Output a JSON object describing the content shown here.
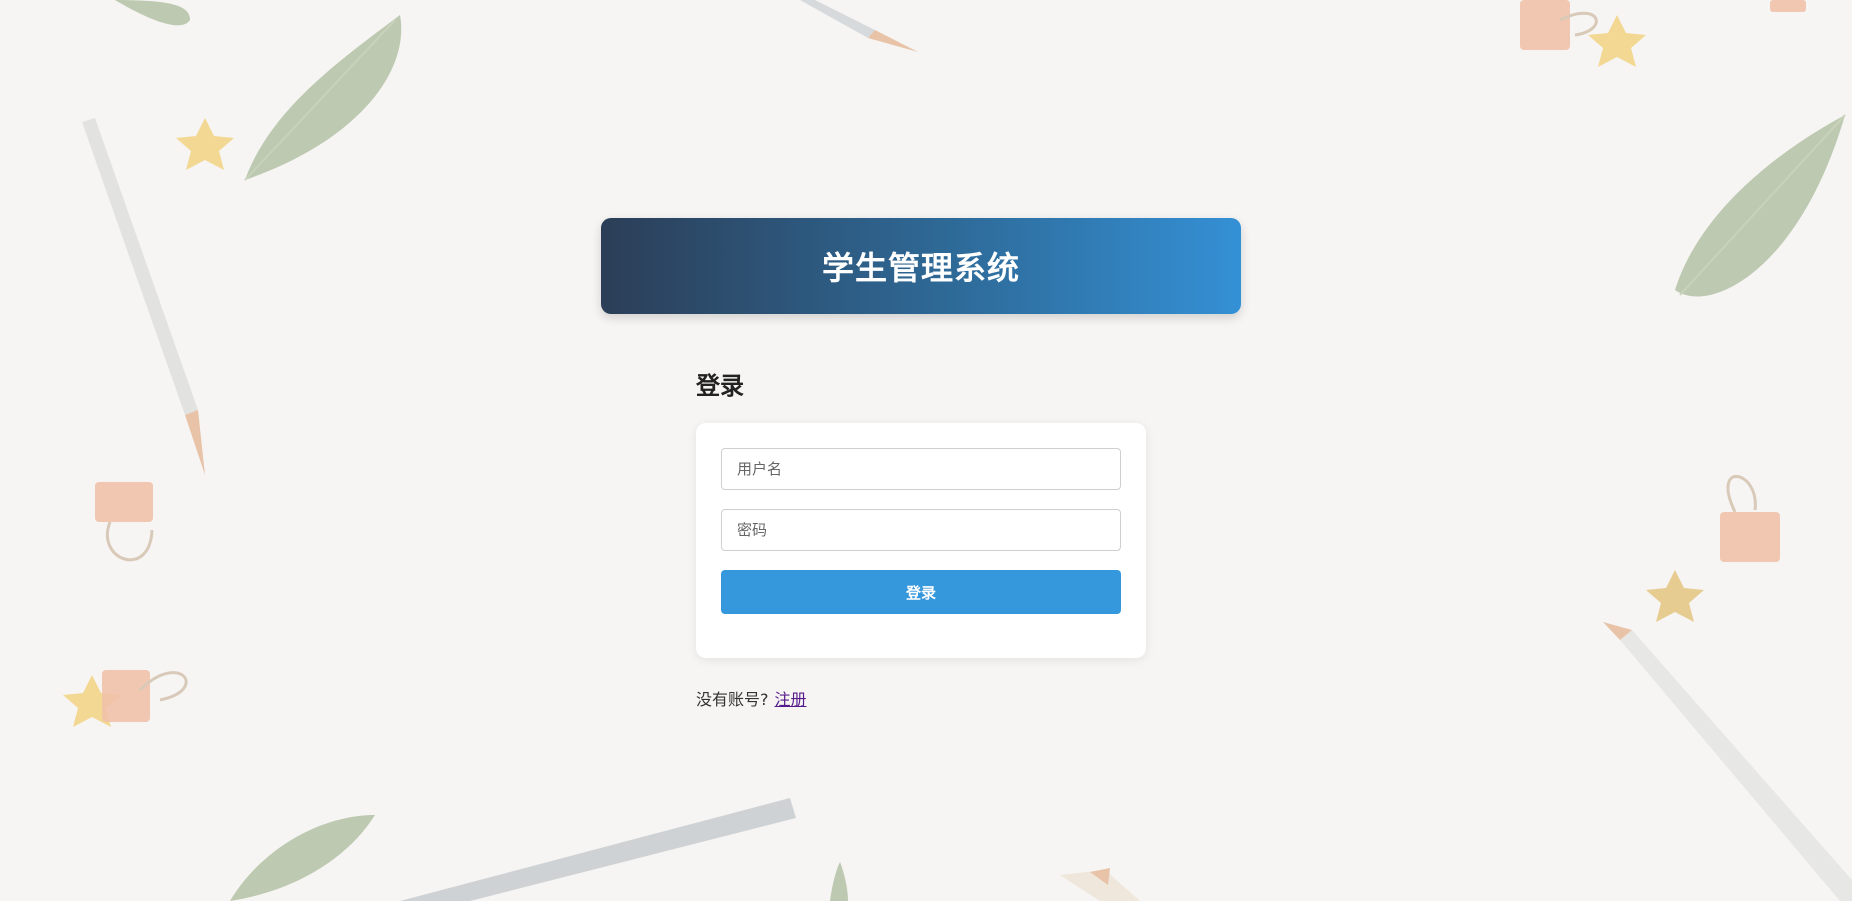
{
  "header": {
    "title": "学生管理系统"
  },
  "login": {
    "section_title": "登录",
    "username_placeholder": "用户名",
    "password_placeholder": "密码",
    "submit_label": "登录"
  },
  "register": {
    "prompt": "没有账号?",
    "link_label": "注册"
  },
  "colors": {
    "header_gradient_start": "#2c3e57",
    "header_gradient_end": "#3490d5",
    "primary_button": "#3597dc",
    "page_background": "#f6f5f3",
    "visited_link": "#551a8b"
  },
  "decorations": [
    "leaf-icon",
    "pencil-icon",
    "star-icon",
    "binder-clip-icon"
  ]
}
